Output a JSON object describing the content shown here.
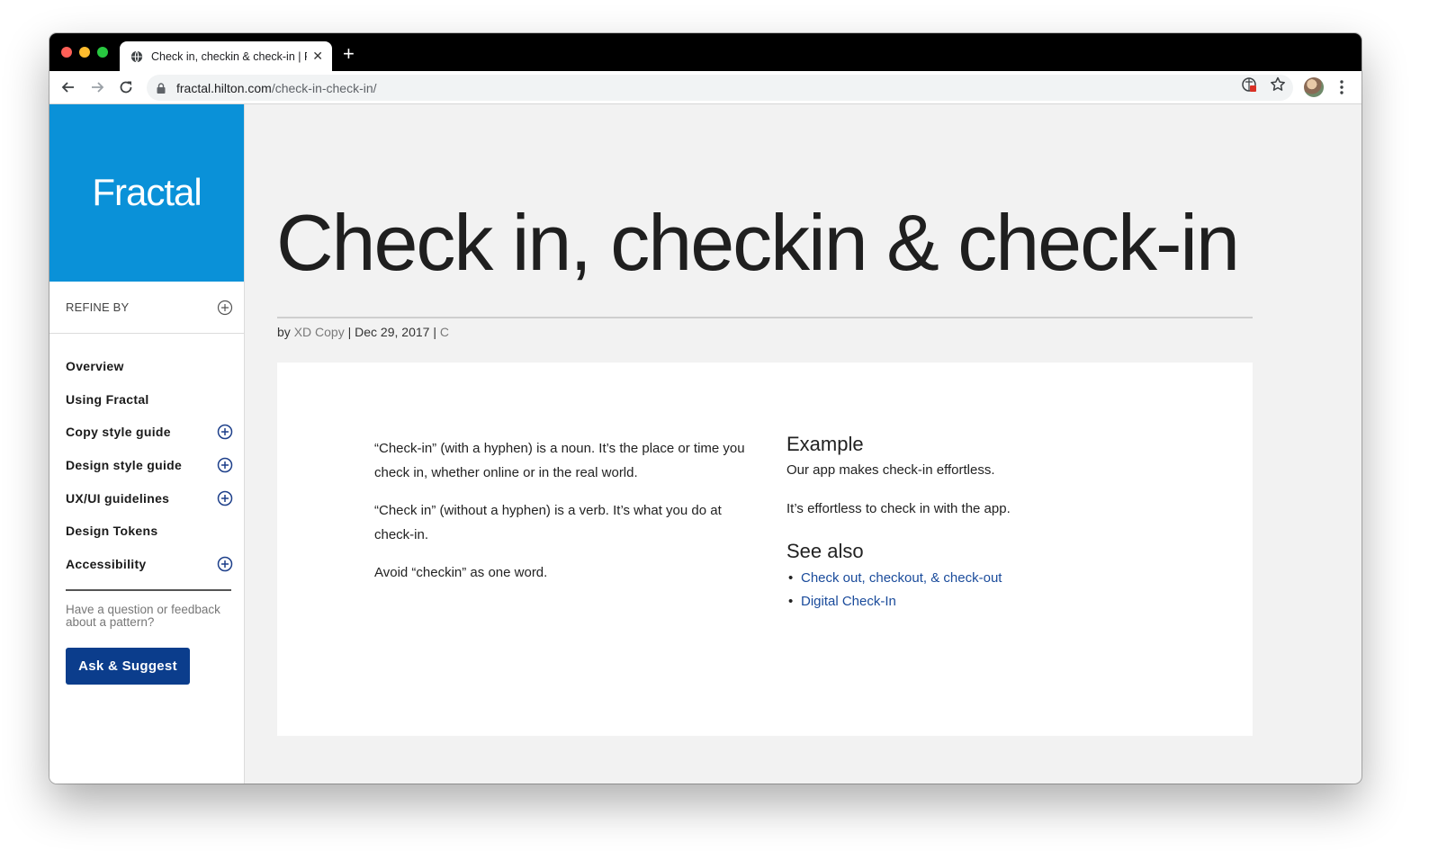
{
  "browser": {
    "tab_title": "Check in, checkin & check-in | Fractal",
    "url_host": "fractal.hilton.com",
    "url_path": "/check-in-check-in/",
    "icons": {
      "tab": "globe-icon",
      "close": "close-icon",
      "new_tab": "plus-icon",
      "back": "back-arrow-icon",
      "forward": "forward-arrow-icon",
      "reload": "reload-icon",
      "lock": "lock-icon",
      "extension": "extension-icon",
      "bookmark": "star-icon",
      "profile": "avatar",
      "menu": "kebab-menu-icon"
    }
  },
  "sidebar": {
    "brand": "Fractal",
    "refine_label": "REFINE BY",
    "items": [
      {
        "label": "Overview",
        "expandable": false
      },
      {
        "label": "Using Fractal",
        "expandable": false
      },
      {
        "label": "Copy style guide",
        "expandable": true
      },
      {
        "label": "Design style guide",
        "expandable": true
      },
      {
        "label": "UX/UI guidelines",
        "expandable": true
      },
      {
        "label": "Design Tokens",
        "expandable": false
      },
      {
        "label": "Accessibility",
        "expandable": true
      }
    ],
    "feedback_text": "Have a question or feedback about a pattern?",
    "ask_button": "Ask & Suggest"
  },
  "article": {
    "title": "Check in, checkin & check-in",
    "byline": {
      "prefix": "by ",
      "author": "XD Copy",
      "sep1": " | ",
      "date": "Dec 29, 2017",
      "sep2": " | ",
      "category": "C"
    },
    "paragraphs": [
      "“Check-in” (with a hyphen) is a noun. It’s the place or time you check in, whether online or in the real world.",
      "“Check in” (without a hyphen) is a verb. It’s what you do at check-in.",
      "Avoid “checkin” as one word."
    ],
    "example_heading": "Example",
    "examples": [
      "Our app makes check-in effortless.",
      "It’s effortless to check in with the app."
    ],
    "see_also_heading": "See also",
    "see_also_links": [
      "Check out, checkout, & check-out",
      "Digital Check-In"
    ]
  },
  "colors": {
    "brand_blue": "#0a91d8",
    "button_navy": "#0b3d8c",
    "link_blue": "#1a4b9b",
    "page_bg": "#f2f2f2"
  }
}
